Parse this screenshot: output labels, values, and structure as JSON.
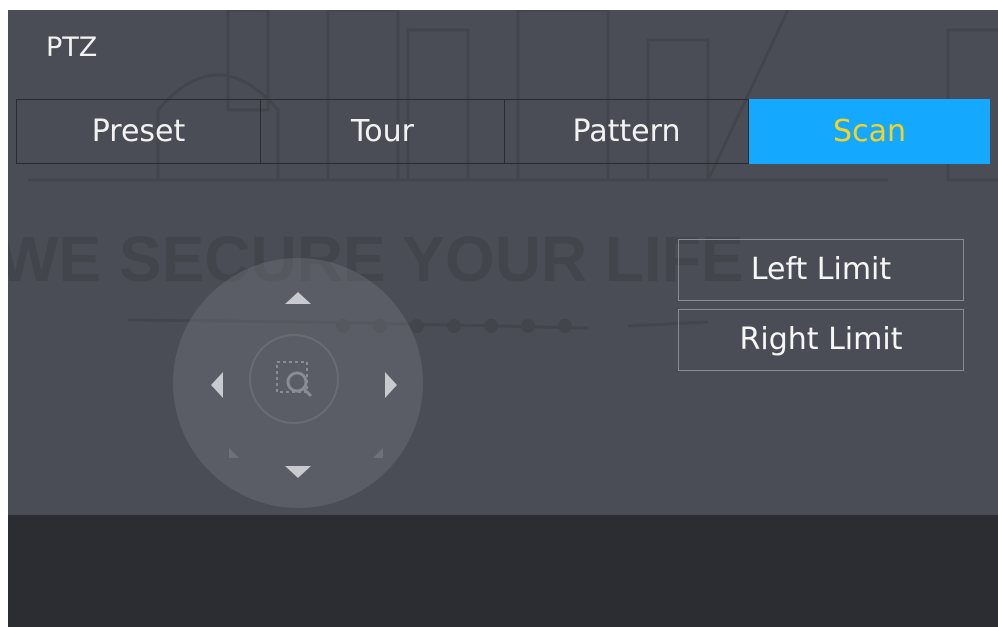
{
  "window": {
    "title": "PTZ"
  },
  "tabs": [
    {
      "label": "Preset",
      "active": false
    },
    {
      "label": "Tour",
      "active": false
    },
    {
      "label": "Pattern",
      "active": false
    },
    {
      "label": "Scan",
      "active": true
    }
  ],
  "scan": {
    "left_limit_label": "Left Limit",
    "right_limit_label": "Right Limit"
  },
  "watermark": {
    "slogan": "WE SECURE YOUR LIFE"
  },
  "colors": {
    "panel_bg": "#4b4d56",
    "lower_bg": "#2c2d33",
    "active_tab_bg": "#14a8ff",
    "active_tab_text": "#f7d21f"
  },
  "icons": {
    "up": "chevron-up-icon",
    "down": "chevron-down-icon",
    "left": "chevron-left-icon",
    "right": "chevron-right-icon",
    "zoom": "zoom-area-icon"
  }
}
